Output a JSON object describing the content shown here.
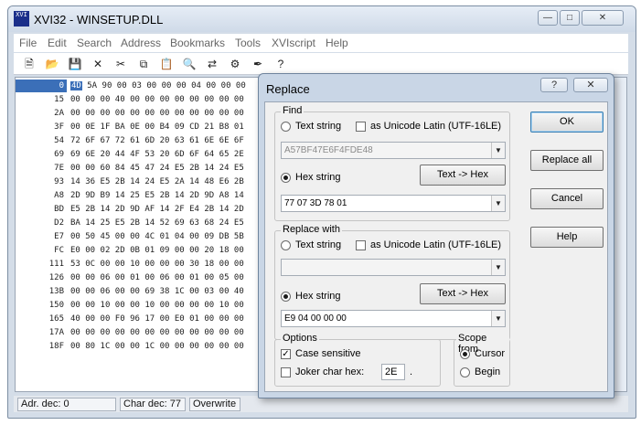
{
  "window": {
    "title": "XVI32 - WINSETUP.DLL",
    "icon_text": "XVI"
  },
  "menu": [
    "File",
    "Edit",
    "Search",
    "Address",
    "Bookmarks",
    "Tools",
    "XVIscript",
    "Help"
  ],
  "toolbar": [
    "new-icon",
    "open-icon",
    "save-icon",
    "close-icon",
    "cut-icon",
    "copy-icon",
    "paste-icon",
    "find-icon",
    "replace-icon",
    "options-icon",
    "script-icon",
    "help-icon"
  ],
  "hex": {
    "offsets": [
      "0",
      "15",
      "2A",
      "3F",
      "54",
      "69",
      "7E",
      "93",
      "A8",
      "BD",
      "D2",
      "E7",
      "FC",
      "111",
      "126",
      "13B",
      "150",
      "165",
      "17A",
      "18F"
    ],
    "rows": [
      [
        "4D",
        "5A",
        "90",
        "00",
        "03",
        "00",
        "00",
        "00",
        "04",
        "00",
        "00",
        "00"
      ],
      [
        "00",
        "00",
        "00",
        "40",
        "00",
        "00",
        "00",
        "00",
        "00",
        "00",
        "00",
        "00"
      ],
      [
        "00",
        "00",
        "00",
        "00",
        "00",
        "00",
        "00",
        "00",
        "00",
        "00",
        "00",
        "00"
      ],
      [
        "00",
        "0E",
        "1F",
        "BA",
        "0E",
        "00",
        "B4",
        "09",
        "CD",
        "21",
        "B8",
        "01"
      ],
      [
        "72",
        "6F",
        "67",
        "72",
        "61",
        "6D",
        "20",
        "63",
        "61",
        "6E",
        "6E",
        "6F"
      ],
      [
        "69",
        "6E",
        "20",
        "44",
        "4F",
        "53",
        "20",
        "6D",
        "6F",
        "64",
        "65",
        "2E"
      ],
      [
        "00",
        "00",
        "60",
        "84",
        "45",
        "47",
        "24",
        "E5",
        "2B",
        "14",
        "24",
        "E5"
      ],
      [
        "14",
        "36",
        "E5",
        "2B",
        "14",
        "24",
        "E5",
        "2A",
        "14",
        "48",
        "E6",
        "2B"
      ],
      [
        "2D",
        "9D",
        "B9",
        "14",
        "25",
        "E5",
        "2B",
        "14",
        "2D",
        "9D",
        "A8",
        "14"
      ],
      [
        "E5",
        "2B",
        "14",
        "2D",
        "9D",
        "AF",
        "14",
        "2F",
        "E4",
        "2B",
        "14",
        "2D"
      ],
      [
        "BA",
        "14",
        "25",
        "E5",
        "2B",
        "14",
        "52",
        "69",
        "63",
        "68",
        "24",
        "E5"
      ],
      [
        "00",
        "50",
        "45",
        "00",
        "00",
        "4C",
        "01",
        "04",
        "00",
        "09",
        "DB",
        "5B"
      ],
      [
        "E0",
        "00",
        "02",
        "2D",
        "0B",
        "01",
        "09",
        "00",
        "00",
        "20",
        "18",
        "00"
      ],
      [
        "53",
        "0C",
        "00",
        "00",
        "10",
        "00",
        "00",
        "00",
        "30",
        "18",
        "00",
        "00"
      ],
      [
        "00",
        "00",
        "06",
        "00",
        "01",
        "00",
        "06",
        "00",
        "01",
        "00",
        "05",
        "00"
      ],
      [
        "00",
        "00",
        "06",
        "00",
        "00",
        "69",
        "38",
        "1C",
        "00",
        "03",
        "00",
        "40"
      ],
      [
        "00",
        "00",
        "10",
        "00",
        "00",
        "10",
        "00",
        "00",
        "00",
        "00",
        "10",
        "00"
      ],
      [
        "40",
        "00",
        "00",
        "F0",
        "96",
        "17",
        "00",
        "E0",
        "01",
        "00",
        "00",
        "00"
      ],
      [
        "00",
        "00",
        "00",
        "00",
        "00",
        "00",
        "00",
        "00",
        "00",
        "00",
        "00",
        "00"
      ],
      [
        "00",
        "80",
        "1C",
        "00",
        "00",
        "1C",
        "00",
        "00",
        "00",
        "00",
        "00",
        "00"
      ]
    ]
  },
  "status": {
    "adr": "Adr. dec: 0",
    "char": "Char dec: 77",
    "mode": "Overwrite"
  },
  "dialog": {
    "title": "Replace",
    "help_btn": "?",
    "close_btn": "✕",
    "find": {
      "label": "Find",
      "text_string": "Text string",
      "unicode": "as Unicode Latin (UTF-16LE)",
      "text_value": "A57BF47E6F4FDE48",
      "hex_string": "Hex string",
      "convert": "Text -> Hex",
      "hex_value": "77 07 3D 78 01"
    },
    "replace": {
      "label": "Replace with",
      "text_string": "Text string",
      "unicode": "as Unicode Latin (UTF-16LE)",
      "text_value": "",
      "hex_string": "Hex string",
      "convert": "Text -> Hex",
      "hex_value": "E9 04 00 00 00"
    },
    "options": {
      "label": "Options",
      "case_sensitive": "Case sensitive",
      "joker": "Joker char hex:",
      "joker_value": "2E",
      "joker_suffix": "."
    },
    "scope": {
      "label": "Scope from",
      "cursor": "Cursor",
      "begin": "Begin"
    },
    "buttons": {
      "ok": "OK",
      "replace_all": "Replace all",
      "cancel": "Cancel",
      "help": "Help"
    }
  }
}
